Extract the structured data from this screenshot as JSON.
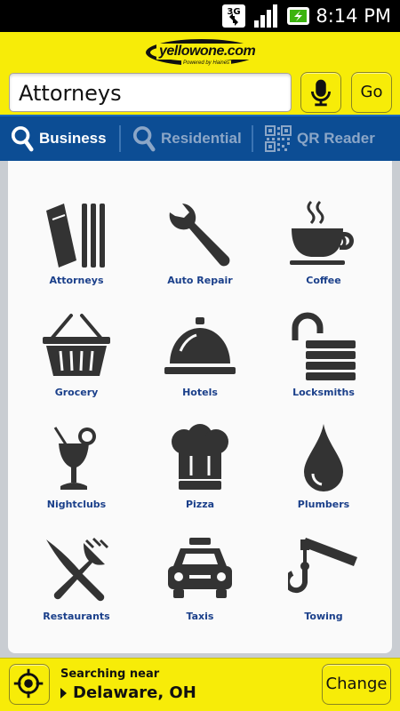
{
  "status_bar": {
    "time": "8:14 PM",
    "network": "3G",
    "icons": [
      "3g-data-icon",
      "signal-strength-icon",
      "battery-charging-icon"
    ]
  },
  "header": {
    "logo_text": "yellowone.com",
    "logo_tagline": "Powered by Haines"
  },
  "search": {
    "value": "Attorneys",
    "mic_icon": "microphone-icon",
    "go_label": "Go"
  },
  "tabs": [
    {
      "label": "Business",
      "icon": "search-icon",
      "active": true
    },
    {
      "label": "Residential",
      "icon": "search-icon",
      "active": false
    },
    {
      "label": "QR Reader",
      "icon": "qr-code-icon",
      "active": false
    }
  ],
  "categories": [
    {
      "label": "Attorneys",
      "icon": "books-icon"
    },
    {
      "label": "Auto Repair",
      "icon": "wrench-icon"
    },
    {
      "label": "Coffee",
      "icon": "coffee-cup-icon"
    },
    {
      "label": "Grocery",
      "icon": "basket-icon"
    },
    {
      "label": "Hotels",
      "icon": "service-bell-icon"
    },
    {
      "label": "Locksmiths",
      "icon": "padlock-icon"
    },
    {
      "label": "Nightclubs",
      "icon": "cocktail-icon"
    },
    {
      "label": "Pizza",
      "icon": "chef-hat-icon"
    },
    {
      "label": "Plumbers",
      "icon": "water-drop-icon"
    },
    {
      "label": "Restaurants",
      "icon": "knife-fork-icon"
    },
    {
      "label": "Taxis",
      "icon": "taxi-icon"
    },
    {
      "label": "Towing",
      "icon": "tow-hook-icon"
    }
  ],
  "footer": {
    "searching_near_label": "Searching near",
    "location": "Delaware, OH",
    "change_label": "Change",
    "locate_icon": "crosshair-icon"
  },
  "colors": {
    "brand_yellow": "#f7ec08",
    "tab_blue": "#0c4d94",
    "icon_gray": "#333333",
    "label_blue": "#1a3f8a"
  }
}
